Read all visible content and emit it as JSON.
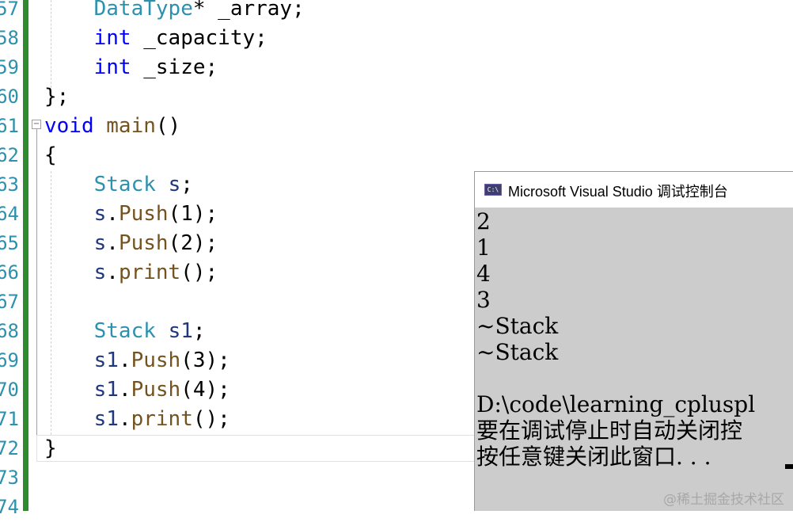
{
  "editor": {
    "line_numbers": [
      "57",
      "58",
      "59",
      "60",
      "61",
      "62",
      "63",
      "64",
      "65",
      "66",
      "67",
      "68",
      "69",
      "70",
      "71",
      "72",
      "73",
      "74"
    ],
    "lines": [
      {
        "indent": "    ",
        "tokens": [
          {
            "t": "DataType",
            "c": "type"
          },
          {
            "t": "* _array;",
            "c": "punct"
          }
        ]
      },
      {
        "indent": "    ",
        "tokens": [
          {
            "t": "int",
            "c": "kw"
          },
          {
            "t": " _capacity;",
            "c": "punct"
          }
        ]
      },
      {
        "indent": "    ",
        "tokens": [
          {
            "t": "int",
            "c": "kw"
          },
          {
            "t": " _size;",
            "c": "punct"
          }
        ]
      },
      {
        "indent": "",
        "tokens": [
          {
            "t": "};",
            "c": "punct"
          }
        ]
      },
      {
        "indent": "",
        "tokens": [
          {
            "t": "void",
            "c": "kw"
          },
          {
            "t": " ",
            "c": "punct"
          },
          {
            "t": "main",
            "c": "fn"
          },
          {
            "t": "()",
            "c": "punct"
          }
        ]
      },
      {
        "indent": "",
        "tokens": [
          {
            "t": "{",
            "c": "punct"
          }
        ]
      },
      {
        "indent": "    ",
        "tokens": [
          {
            "t": "Stack",
            "c": "type"
          },
          {
            "t": " ",
            "c": "punct"
          },
          {
            "t": "s",
            "c": "var"
          },
          {
            "t": ";",
            "c": "punct"
          }
        ]
      },
      {
        "indent": "    ",
        "tokens": [
          {
            "t": "s",
            "c": "var"
          },
          {
            "t": ".",
            "c": "punct"
          },
          {
            "t": "Push",
            "c": "fn"
          },
          {
            "t": "(1);",
            "c": "punct"
          }
        ]
      },
      {
        "indent": "    ",
        "tokens": [
          {
            "t": "s",
            "c": "var"
          },
          {
            "t": ".",
            "c": "punct"
          },
          {
            "t": "Push",
            "c": "fn"
          },
          {
            "t": "(2);",
            "c": "punct"
          }
        ]
      },
      {
        "indent": "    ",
        "tokens": [
          {
            "t": "s",
            "c": "var"
          },
          {
            "t": ".",
            "c": "punct"
          },
          {
            "t": "print",
            "c": "fn"
          },
          {
            "t": "();",
            "c": "punct"
          }
        ]
      },
      {
        "indent": "",
        "tokens": []
      },
      {
        "indent": "    ",
        "tokens": [
          {
            "t": "Stack",
            "c": "type"
          },
          {
            "t": " ",
            "c": "punct"
          },
          {
            "t": "s1",
            "c": "var"
          },
          {
            "t": ";",
            "c": "punct"
          }
        ]
      },
      {
        "indent": "    ",
        "tokens": [
          {
            "t": "s1",
            "c": "var"
          },
          {
            "t": ".",
            "c": "punct"
          },
          {
            "t": "Push",
            "c": "fn"
          },
          {
            "t": "(3);",
            "c": "punct"
          }
        ]
      },
      {
        "indent": "    ",
        "tokens": [
          {
            "t": "s1",
            "c": "var"
          },
          {
            "t": ".",
            "c": "punct"
          },
          {
            "t": "Push",
            "c": "fn"
          },
          {
            "t": "(4);",
            "c": "punct"
          }
        ]
      },
      {
        "indent": "    ",
        "tokens": [
          {
            "t": "s1",
            "c": "var"
          },
          {
            "t": ".",
            "c": "punct"
          },
          {
            "t": "print",
            "c": "fn"
          },
          {
            "t": "();",
            "c": "punct"
          }
        ]
      },
      {
        "indent": "",
        "tokens": [
          {
            "t": "}",
            "c": "punct"
          }
        ]
      },
      {
        "indent": "",
        "tokens": []
      },
      {
        "indent": "",
        "tokens": []
      }
    ],
    "colors": {
      "keyword": "#0000ff",
      "type": "#2b91af",
      "function": "#74531f",
      "variable": "#1f377f",
      "change_bar": "#2e8b2e"
    }
  },
  "console": {
    "icon_label": "C:\\",
    "title": "Microsoft Visual Studio 调试控制台",
    "output": [
      "2",
      "1",
      "4",
      "3",
      "~Stack",
      "~Stack",
      "",
      "D:\\code\\learning_cpluspl",
      "要在调试停止时自动关闭控",
      "按任意键关闭此窗口. . ."
    ]
  },
  "watermark": "@稀土掘金技术社区"
}
